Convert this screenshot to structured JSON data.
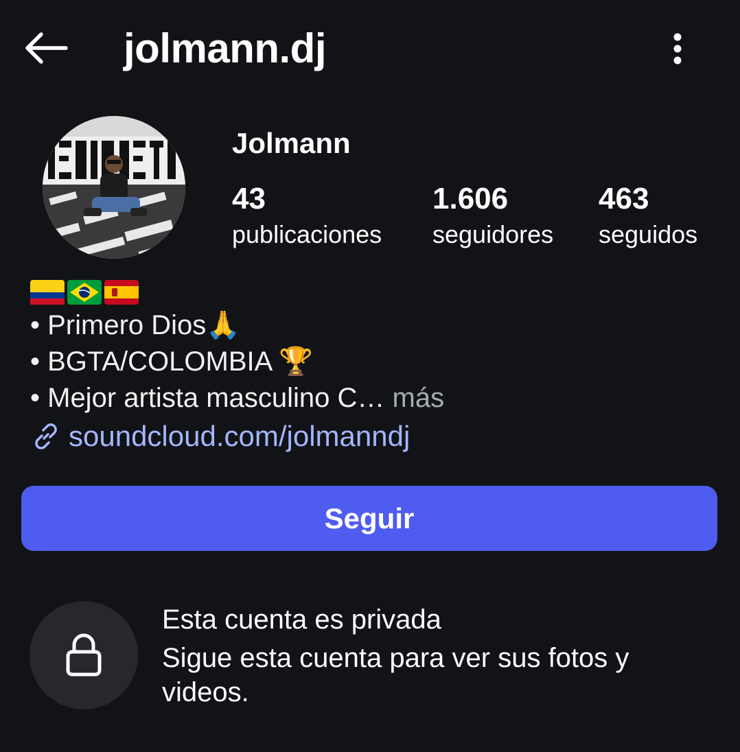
{
  "header": {
    "back_icon": "arrow-left-icon",
    "username": "jolmann.dj",
    "more_icon": "more-vertical-icon"
  },
  "profile": {
    "display_name": "Jolmann",
    "stats": [
      {
        "value": "43",
        "label": "publicaciones"
      },
      {
        "value": "1.606",
        "label": "seguidores"
      },
      {
        "value": "463",
        "label": "seguidos"
      }
    ],
    "bio": {
      "flags": [
        "colombia-flag-icon",
        "brazil-flag-icon",
        "spain-flag-icon"
      ],
      "lines": [
        "• Primero Dios🙏",
        "• BGTA/COLOMBIA 🏆",
        "• Mejor artista masculino C…"
      ],
      "more_label": "más",
      "link_icon": "link-icon",
      "link_text": "soundcloud.com/jolmanndj"
    },
    "follow_label": "Seguir"
  },
  "private_notice": {
    "icon": "lock-icon",
    "title": "Esta cuenta es privada",
    "description": "Sigue esta cuenta para ver sus fotos y videos."
  },
  "colors": {
    "background": "#121317",
    "accent": "#4f5cf0",
    "link": "#a4b6ff",
    "muted": "#a8abb3"
  }
}
